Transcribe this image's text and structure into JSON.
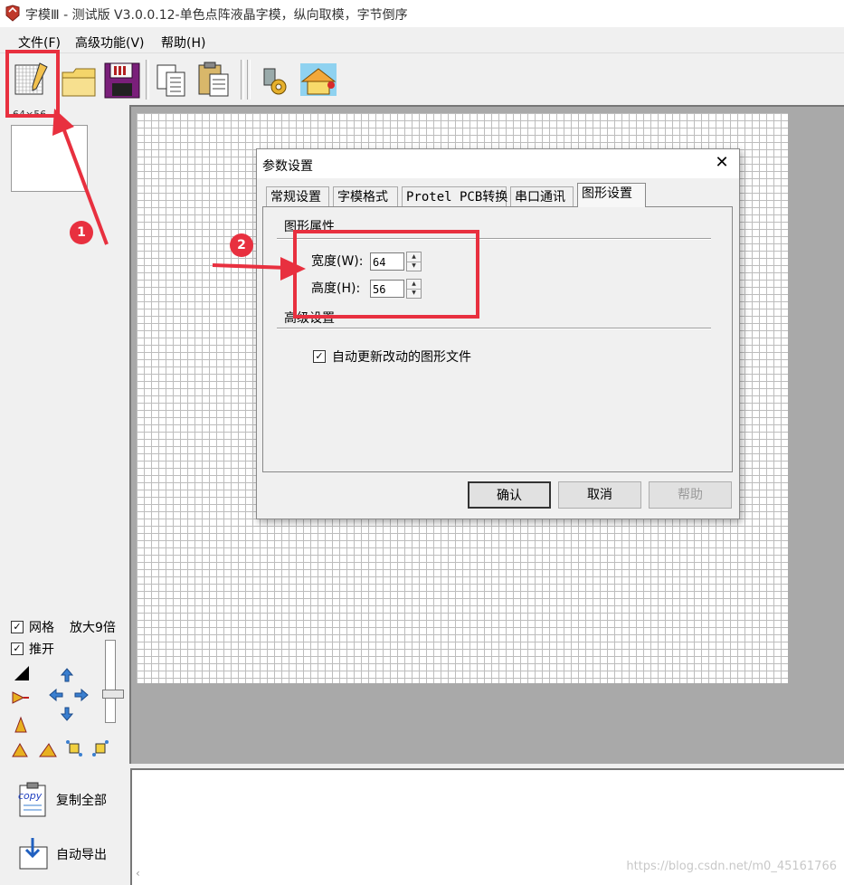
{
  "window": {
    "title": "字模Ⅲ - 测试版 V3.0.0.12-单色点阵液晶字模，纵向取模，字节倒序"
  },
  "menu": [
    "文件(F)",
    "高级功能(V)",
    "帮助(H)"
  ],
  "left_panel": {
    "size_label": "64×56",
    "grid_label": "网格",
    "zoom_label": "放大9倍",
    "push_label": "推开",
    "grid_checked": true,
    "push_checked": true
  },
  "bottom_actions": {
    "copy_all": "复制全部",
    "auto_export": "自动导出",
    "copy_icon_text": "copy"
  },
  "dialog": {
    "title": "参数设置",
    "tabs": [
      "常规设置",
      "字模格式",
      "Protel PCB转换",
      "串口通讯",
      "图形设置"
    ],
    "active_tab": "图形设置",
    "group_graphic": "图形属性",
    "width_label": "宽度(W):",
    "width_value": "64",
    "height_label": "高度(H):",
    "height_value": "56",
    "group_advanced": "高级设置",
    "auto_update_label": "自动更新改动的图形文件",
    "auto_update_checked": true,
    "buttons": {
      "ok": "确认",
      "cancel": "取消",
      "help": "帮助"
    }
  },
  "annotations": {
    "badge1": "1",
    "badge2": "2"
  },
  "watermark": "https://blog.csdn.net/m0_45161766",
  "colors": {
    "annotation_red": "#e8303f",
    "canvas_bg": "#a9a9a9",
    "grid_line": "#bdbdbd"
  }
}
